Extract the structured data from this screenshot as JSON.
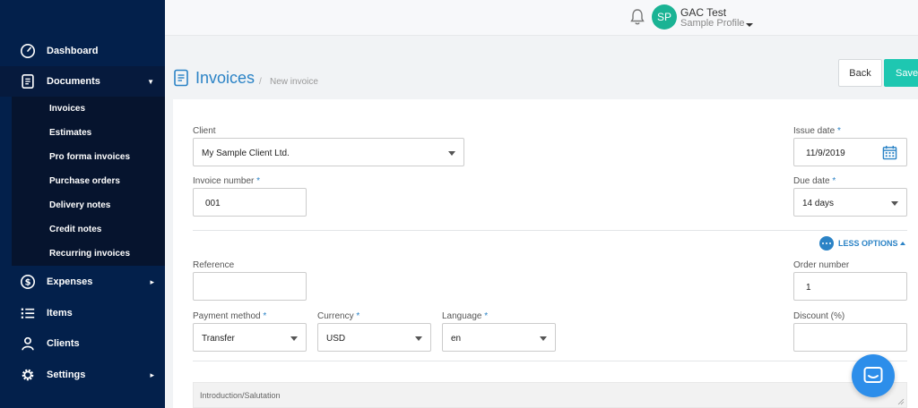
{
  "sidebar": {
    "items": [
      {
        "label": "Dashboard",
        "icon": "speedometer-icon"
      },
      {
        "label": "Documents",
        "icon": "document-icon",
        "expanded": true
      },
      {
        "label": "Expenses",
        "icon": "dollar-icon"
      },
      {
        "label": "Items",
        "icon": "list-icon"
      },
      {
        "label": "Clients",
        "icon": "user-icon"
      },
      {
        "label": "Settings",
        "icon": "gear-icon"
      }
    ],
    "documents_sub": [
      "Invoices",
      "Estimates",
      "Pro forma invoices",
      "Purchase orders",
      "Delivery notes",
      "Credit notes",
      "Recurring invoices"
    ]
  },
  "topbar": {
    "avatar_initials": "SP",
    "user_name": "GAC Test",
    "user_profile": "Sample Profile"
  },
  "header": {
    "title": "Invoices",
    "separator": "/",
    "breadcrumb": "New invoice",
    "back_label": "Back",
    "save_label": "Save"
  },
  "form": {
    "client": {
      "label": "Client",
      "value": "My Sample Client Ltd."
    },
    "issue_date": {
      "label": "Issue date",
      "required": "*",
      "value": "11/9/2019"
    },
    "invoice_number": {
      "label": "Invoice number",
      "required": "*",
      "value": "001"
    },
    "due_date": {
      "label": "Due date",
      "required": "*",
      "value": "14 days"
    },
    "less_options_label": "LESS OPTIONS",
    "reference": {
      "label": "Reference",
      "value": ""
    },
    "order_number": {
      "label": "Order number",
      "value": "1"
    },
    "payment_method": {
      "label": "Payment method",
      "required": "*",
      "value": "Transfer"
    },
    "currency": {
      "label": "Currency",
      "required": "*",
      "value": "USD"
    },
    "language": {
      "label": "Language",
      "required": "*",
      "value": "en"
    },
    "discount": {
      "label": "Discount (%)",
      "value": ""
    },
    "introduction_placeholder": "Introduction/Salutation"
  },
  "colors": {
    "sidebar_bg": "#03204b",
    "accent": "#2b83c6",
    "save_button": "#1ec7b1",
    "avatar": "#1ab394",
    "chat_button": "#2d8eea"
  }
}
